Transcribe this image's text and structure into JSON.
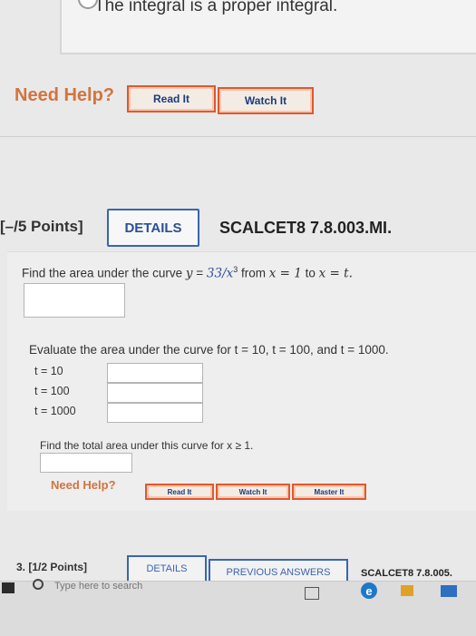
{
  "prev_answer": {
    "text": "The integral is a proper integral."
  },
  "help1": {
    "label": "Need Help?",
    "read": "Read It",
    "watch": "Watch It"
  },
  "q2": {
    "points": "[–/5 Points]",
    "details": "DETAILS",
    "code": "SCALCET8 7.8.003.MI.",
    "prompt_prefix": "Find the area under the curve ",
    "y_lhs": "y",
    "y_rhs": "33/x",
    "exponent": "3",
    "from_text": " from ",
    "x_eq_1": "x = 1",
    "to_text": " to ",
    "x_eq_t": "x = t.",
    "evaluate_prompt": "Evaluate the area under the curve for t = 10, t = 100, and t = 1000.",
    "t_rows": [
      {
        "label": "t = 10",
        "value": ""
      },
      {
        "label": "t = 100",
        "value": ""
      },
      {
        "label": "t = 1000",
        "value": ""
      }
    ],
    "total_prompt": "Find the total area under this curve for x ≥ 1.",
    "help_label": "Need Help?",
    "read": "Read It",
    "watch": "Watch It",
    "master": "Master It"
  },
  "q3": {
    "points": "3. [1/2 Points]",
    "details": "DETAILS",
    "previous_answers": "PREVIOUS ANSWERS",
    "code": "SCALCET8 7.8.005."
  },
  "taskbar": {
    "search_placeholder": "Type here to search"
  },
  "colors": {
    "accent": "#3a64b2",
    "help": "#d2743d",
    "button_border": "#e2582b"
  }
}
